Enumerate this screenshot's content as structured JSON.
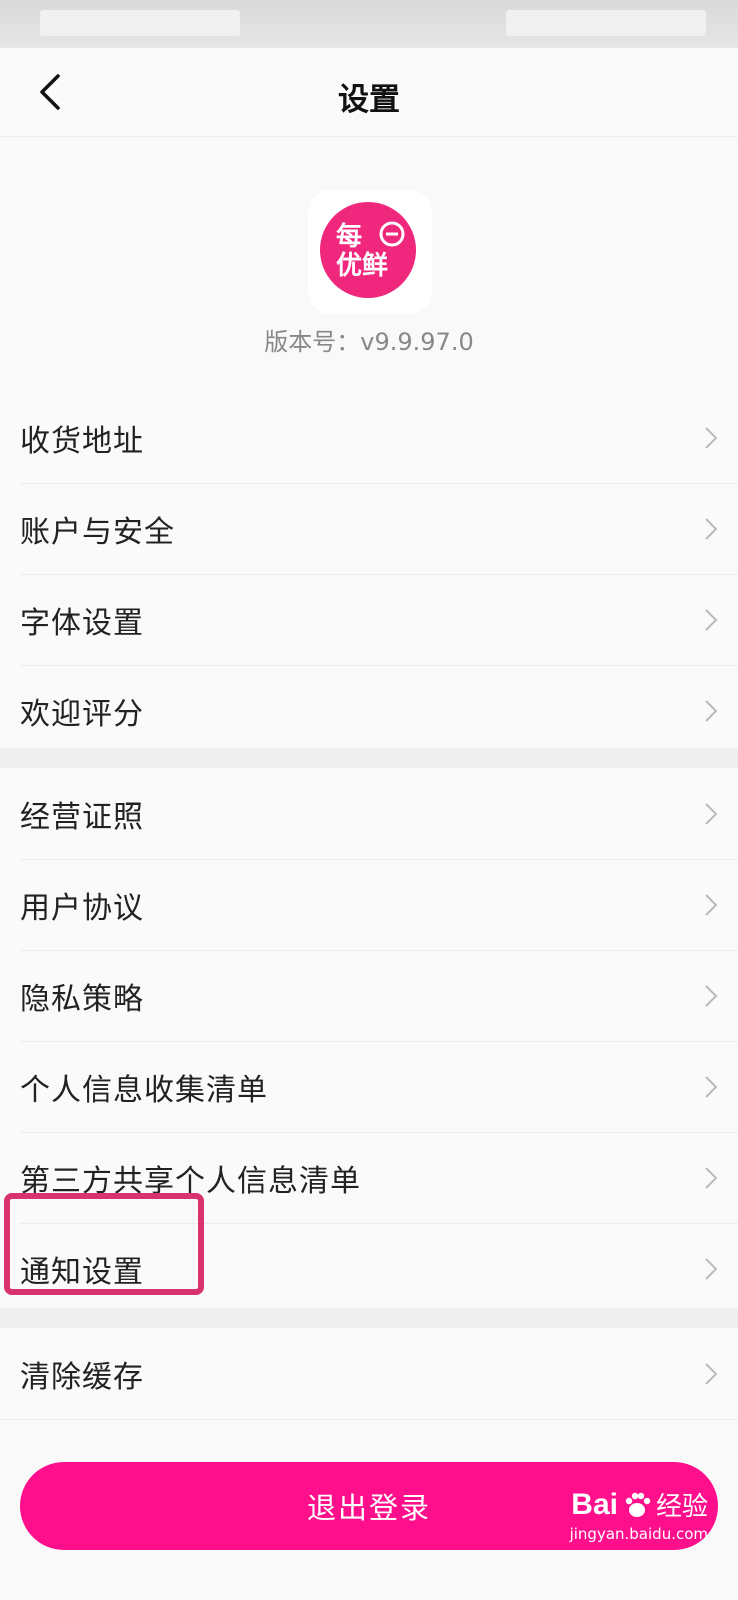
{
  "header": {
    "title": "设置"
  },
  "app": {
    "logo_text": "每日优鲜",
    "version": "版本号：v9.9.97.0"
  },
  "section1": {
    "items": [
      {
        "label": "收货地址"
      },
      {
        "label": "账户与安全"
      },
      {
        "label": "字体设置"
      },
      {
        "label": "欢迎评分"
      }
    ]
  },
  "section2": {
    "items": [
      {
        "label": "经营证照"
      },
      {
        "label": "用户协议"
      },
      {
        "label": "隐私策略"
      },
      {
        "label": "个人信息收集清单"
      },
      {
        "label": "第三方共享个人信息清单"
      },
      {
        "label": "通知设置"
      }
    ]
  },
  "section3": {
    "items": [
      {
        "label": "清除缓存"
      }
    ]
  },
  "logout": {
    "label": "退出登录"
  },
  "watermark": {
    "brand": "Bai",
    "tail": "经验",
    "url": "jingyan.baidu.com"
  },
  "colors": {
    "accent": "#ff0f8c",
    "highlight": "#d9336f",
    "logo": "#f0287d"
  },
  "icons": {
    "back": "chevron-left-icon",
    "row": "chevron-right-icon",
    "paw": "paw-icon"
  }
}
